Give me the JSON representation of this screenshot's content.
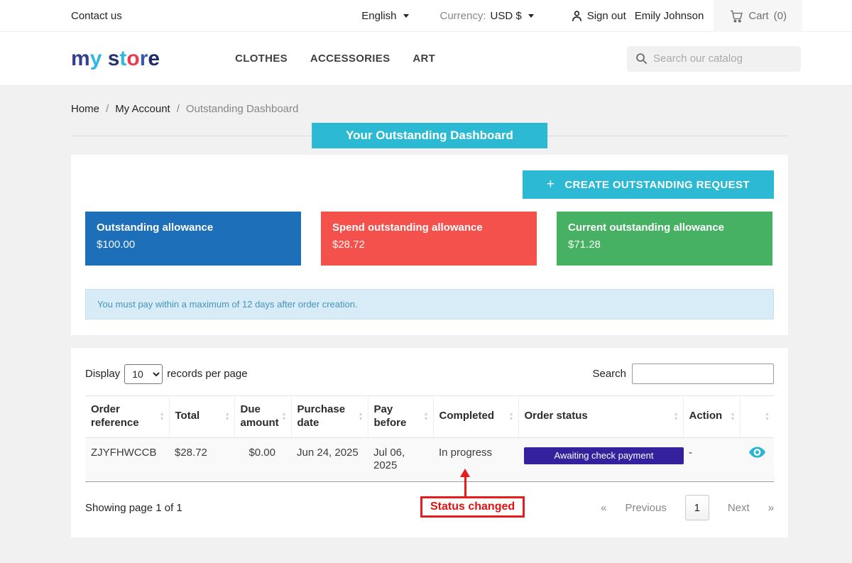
{
  "topbar": {
    "contact": "Contact us",
    "language": "English",
    "currency_label": "Currency:",
    "currency_value": "USD $",
    "signout": "Sign out",
    "user_name": "Emily Johnson",
    "cart_label": "Cart",
    "cart_count": "(0)"
  },
  "header": {
    "logo_letters": [
      {
        "ch": "m",
        "color": "#33408f"
      },
      {
        "ch": "y",
        "color": "#2fb6e2"
      },
      {
        "ch": " ",
        "color": "#333333"
      },
      {
        "ch": "s",
        "color": "#24356f"
      },
      {
        "ch": "t",
        "color": "#2fb6e2"
      },
      {
        "ch": "o",
        "color": "#e63e4f"
      },
      {
        "ch": "r",
        "color": "#3a57b5"
      },
      {
        "ch": "e",
        "color": "#1f2d66"
      }
    ],
    "nav": [
      "CLOTHES",
      "ACCESSORIES",
      "ART"
    ],
    "search_placeholder": "Search our catalog"
  },
  "breadcrumb": {
    "home": "Home",
    "account": "My Account",
    "current": "Outstanding Dashboard",
    "separator": "/"
  },
  "page": {
    "title": "Your Outstanding Dashboard",
    "create_button": "CREATE OUTSTANDING REQUEST",
    "plus": "+"
  },
  "cards": [
    {
      "label": "Outstanding allowance",
      "value": "$100.00",
      "color": "#1c6fb8"
    },
    {
      "label": "Spend outstanding allowance",
      "value": "$28.72",
      "color": "#f4514c"
    },
    {
      "label": "Current outstanding allowance",
      "value": "$71.28",
      "color": "#47b163"
    }
  ],
  "alert": {
    "text": "You must pay within a maximum of 12 days after order creation."
  },
  "table": {
    "display_label": "Display",
    "page_size": "10",
    "records_label": "records per page",
    "search_label": "Search",
    "headers": {
      "reference": "Order reference",
      "total": "Total",
      "due": "Due amount",
      "purchase": "Purchase date",
      "pay_before": "Pay before",
      "completed": "Completed",
      "status": "Order status",
      "action": "Action",
      "view": ""
    },
    "row": {
      "reference": "ZJYFHWCCB",
      "total": "$28.72",
      "due": "$0.00",
      "purchase": "Jun 24, 2025",
      "pay_before": "Jul 06, 2025",
      "completed": "In progress",
      "status": "Awaiting check payment",
      "action": "-"
    },
    "footer": "Showing page 1 of 1",
    "pagination": {
      "first": "«",
      "previous": "Previous",
      "page": "1",
      "next": "Next",
      "last": "»"
    }
  },
  "annotation": {
    "text": "Status changed"
  },
  "colors": {
    "accent_cyan": "#2cb9d4",
    "status_badge": "#34219e",
    "annotation_red": "#e71c1c",
    "card_blue": "#1c6fb8",
    "card_red": "#f4514c",
    "card_green": "#47b163"
  }
}
